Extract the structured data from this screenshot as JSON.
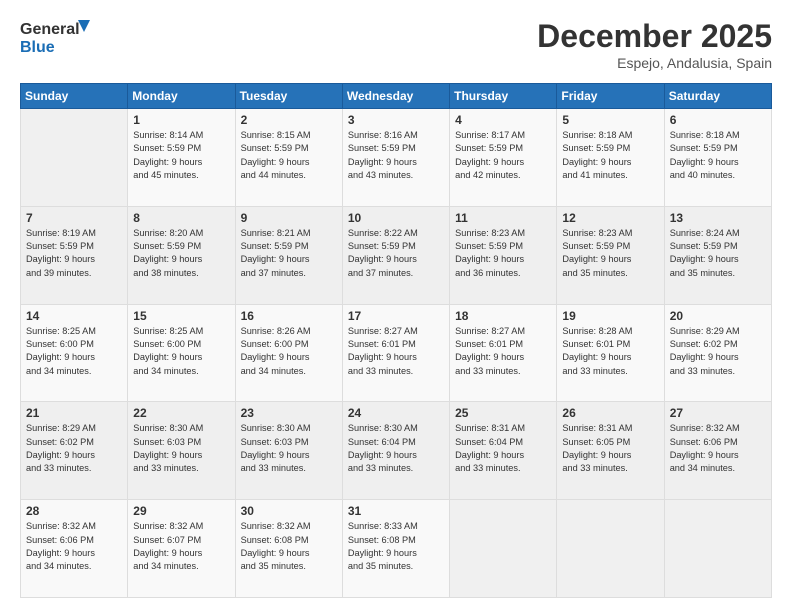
{
  "logo": {
    "line1": "General",
    "line2": "Blue"
  },
  "title": "December 2025",
  "subtitle": "Espejo, Andalusia, Spain",
  "days_header": [
    "Sunday",
    "Monday",
    "Tuesday",
    "Wednesday",
    "Thursday",
    "Friday",
    "Saturday"
  ],
  "weeks": [
    [
      {
        "num": "",
        "info": ""
      },
      {
        "num": "1",
        "info": "Sunrise: 8:14 AM\nSunset: 5:59 PM\nDaylight: 9 hours\nand 45 minutes."
      },
      {
        "num": "2",
        "info": "Sunrise: 8:15 AM\nSunset: 5:59 PM\nDaylight: 9 hours\nand 44 minutes."
      },
      {
        "num": "3",
        "info": "Sunrise: 8:16 AM\nSunset: 5:59 PM\nDaylight: 9 hours\nand 43 minutes."
      },
      {
        "num": "4",
        "info": "Sunrise: 8:17 AM\nSunset: 5:59 PM\nDaylight: 9 hours\nand 42 minutes."
      },
      {
        "num": "5",
        "info": "Sunrise: 8:18 AM\nSunset: 5:59 PM\nDaylight: 9 hours\nand 41 minutes."
      },
      {
        "num": "6",
        "info": "Sunrise: 8:18 AM\nSunset: 5:59 PM\nDaylight: 9 hours\nand 40 minutes."
      }
    ],
    [
      {
        "num": "7",
        "info": "Sunrise: 8:19 AM\nSunset: 5:59 PM\nDaylight: 9 hours\nand 39 minutes."
      },
      {
        "num": "8",
        "info": "Sunrise: 8:20 AM\nSunset: 5:59 PM\nDaylight: 9 hours\nand 38 minutes."
      },
      {
        "num": "9",
        "info": "Sunrise: 8:21 AM\nSunset: 5:59 PM\nDaylight: 9 hours\nand 37 minutes."
      },
      {
        "num": "10",
        "info": "Sunrise: 8:22 AM\nSunset: 5:59 PM\nDaylight: 9 hours\nand 37 minutes."
      },
      {
        "num": "11",
        "info": "Sunrise: 8:23 AM\nSunset: 5:59 PM\nDaylight: 9 hours\nand 36 minutes."
      },
      {
        "num": "12",
        "info": "Sunrise: 8:23 AM\nSunset: 5:59 PM\nDaylight: 9 hours\nand 35 minutes."
      },
      {
        "num": "13",
        "info": "Sunrise: 8:24 AM\nSunset: 5:59 PM\nDaylight: 9 hours\nand 35 minutes."
      }
    ],
    [
      {
        "num": "14",
        "info": "Sunrise: 8:25 AM\nSunset: 6:00 PM\nDaylight: 9 hours\nand 34 minutes."
      },
      {
        "num": "15",
        "info": "Sunrise: 8:25 AM\nSunset: 6:00 PM\nDaylight: 9 hours\nand 34 minutes."
      },
      {
        "num": "16",
        "info": "Sunrise: 8:26 AM\nSunset: 6:00 PM\nDaylight: 9 hours\nand 34 minutes."
      },
      {
        "num": "17",
        "info": "Sunrise: 8:27 AM\nSunset: 6:01 PM\nDaylight: 9 hours\nand 33 minutes."
      },
      {
        "num": "18",
        "info": "Sunrise: 8:27 AM\nSunset: 6:01 PM\nDaylight: 9 hours\nand 33 minutes."
      },
      {
        "num": "19",
        "info": "Sunrise: 8:28 AM\nSunset: 6:01 PM\nDaylight: 9 hours\nand 33 minutes."
      },
      {
        "num": "20",
        "info": "Sunrise: 8:29 AM\nSunset: 6:02 PM\nDaylight: 9 hours\nand 33 minutes."
      }
    ],
    [
      {
        "num": "21",
        "info": "Sunrise: 8:29 AM\nSunset: 6:02 PM\nDaylight: 9 hours\nand 33 minutes."
      },
      {
        "num": "22",
        "info": "Sunrise: 8:30 AM\nSunset: 6:03 PM\nDaylight: 9 hours\nand 33 minutes."
      },
      {
        "num": "23",
        "info": "Sunrise: 8:30 AM\nSunset: 6:03 PM\nDaylight: 9 hours\nand 33 minutes."
      },
      {
        "num": "24",
        "info": "Sunrise: 8:30 AM\nSunset: 6:04 PM\nDaylight: 9 hours\nand 33 minutes."
      },
      {
        "num": "25",
        "info": "Sunrise: 8:31 AM\nSunset: 6:04 PM\nDaylight: 9 hours\nand 33 minutes."
      },
      {
        "num": "26",
        "info": "Sunrise: 8:31 AM\nSunset: 6:05 PM\nDaylight: 9 hours\nand 33 minutes."
      },
      {
        "num": "27",
        "info": "Sunrise: 8:32 AM\nSunset: 6:06 PM\nDaylight: 9 hours\nand 34 minutes."
      }
    ],
    [
      {
        "num": "28",
        "info": "Sunrise: 8:32 AM\nSunset: 6:06 PM\nDaylight: 9 hours\nand 34 minutes."
      },
      {
        "num": "29",
        "info": "Sunrise: 8:32 AM\nSunset: 6:07 PM\nDaylight: 9 hours\nand 34 minutes."
      },
      {
        "num": "30",
        "info": "Sunrise: 8:32 AM\nSunset: 6:08 PM\nDaylight: 9 hours\nand 35 minutes."
      },
      {
        "num": "31",
        "info": "Sunrise: 8:33 AM\nSunset: 6:08 PM\nDaylight: 9 hours\nand 35 minutes."
      },
      {
        "num": "",
        "info": ""
      },
      {
        "num": "",
        "info": ""
      },
      {
        "num": "",
        "info": ""
      }
    ]
  ]
}
